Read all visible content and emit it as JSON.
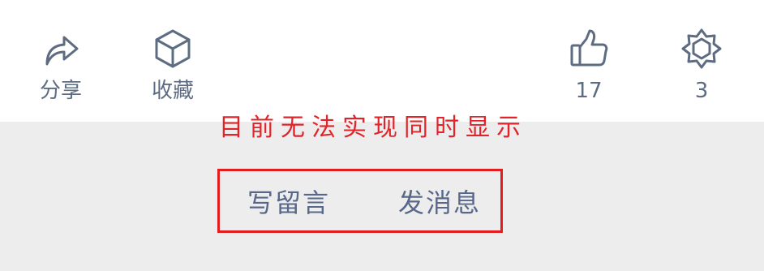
{
  "toolbar": {
    "share": {
      "label": "分享",
      "icon": "share-arrow-icon"
    },
    "collect": {
      "label": "收藏",
      "icon": "cube-icon"
    },
    "like": {
      "count": "17",
      "icon": "thumbs-up-icon"
    },
    "praise": {
      "count": "3",
      "icon": "star-badge-icon"
    }
  },
  "annotation": {
    "text": "目前无法实现同时显示",
    "color": "#e0242a"
  },
  "actions": {
    "comment_label": "写留言",
    "message_label": "发消息",
    "box_color": "#e31d1d"
  },
  "colors": {
    "icon_gray": "#5e6c82",
    "button_text": "#58678a",
    "bottom_background": "#ededed"
  }
}
